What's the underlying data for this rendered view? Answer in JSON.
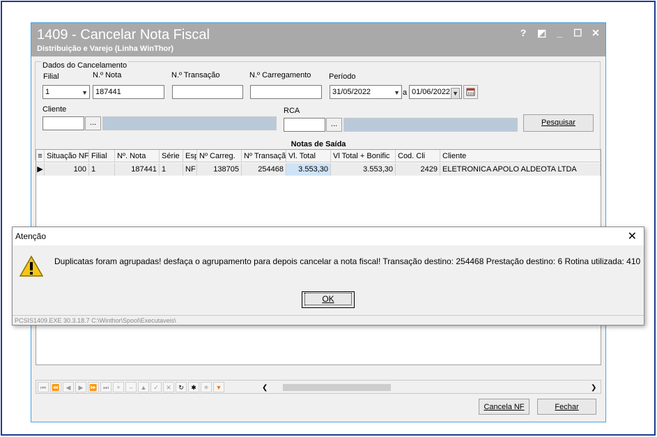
{
  "window": {
    "title": "1409 - Cancelar Nota Fiscal",
    "subtitle": "Distribuição e Varejo (Linha WinThor)",
    "help_glyph": "?",
    "restore_glyph": "◩",
    "minimize_glyph": "_",
    "maximize_glyph": "☐",
    "close_glyph": "✕"
  },
  "filters": {
    "group_label": "Dados do Cancelamento",
    "filial_label": "Filial",
    "filial_value": "1",
    "nota_label": "N.º Nota",
    "nota_value": "187441",
    "transacao_label": "N.º Transação",
    "transacao_value": "",
    "carregamento_label": "N.º Carregamento",
    "carregamento_value": "",
    "periodo_label": "Período",
    "periodo_start": "31/05/2022",
    "periodo_sep": "a",
    "periodo_end": "01/06/2022",
    "cliente_label": "Cliente",
    "cliente_value": "",
    "rca_label": "RCA",
    "rca_value": "",
    "ellipsis": "...",
    "pesquisar_label": "Pesquisar"
  },
  "grid": {
    "title": "Notas de Saída",
    "columns": [
      "Situação NF",
      "Filial",
      "Nº. Nota",
      "Série",
      "Esp",
      "Nº Carreg.",
      "Nº Transação",
      "Vl. Total",
      "Vl Total + Bonific",
      "Cod. Cli",
      "Cliente"
    ],
    "rows": [
      [
        "100",
        "1",
        "187441",
        "1",
        "NF",
        "138705",
        "254468",
        "3.553,30",
        "3.553,30",
        "2429",
        "ELETRONICA APOLO ALDEOTA LTDA"
      ]
    ]
  },
  "footer": {
    "cancel_nf_label": "Cancela NF",
    "fechar_label": "Fechar"
  },
  "dialog": {
    "title": "Atenção",
    "message": "Duplicatas foram agrupadas! desfaça o agrupamento para depois cancelar a nota fiscal! Transação destino: 254468   Prestação destino: 6   Rotina utilizada:  410",
    "ok_label": "OK",
    "status": "PCSIS1409.EXE 30.3.18.7 C:\\Winthor\\Spool\\Executaveis\\"
  },
  "colors": {
    "title_bar": "#a9a9a9",
    "frame_border": "#1f3a93",
    "disabled_field": "#b9c9d9",
    "warning": "#f5c518"
  }
}
